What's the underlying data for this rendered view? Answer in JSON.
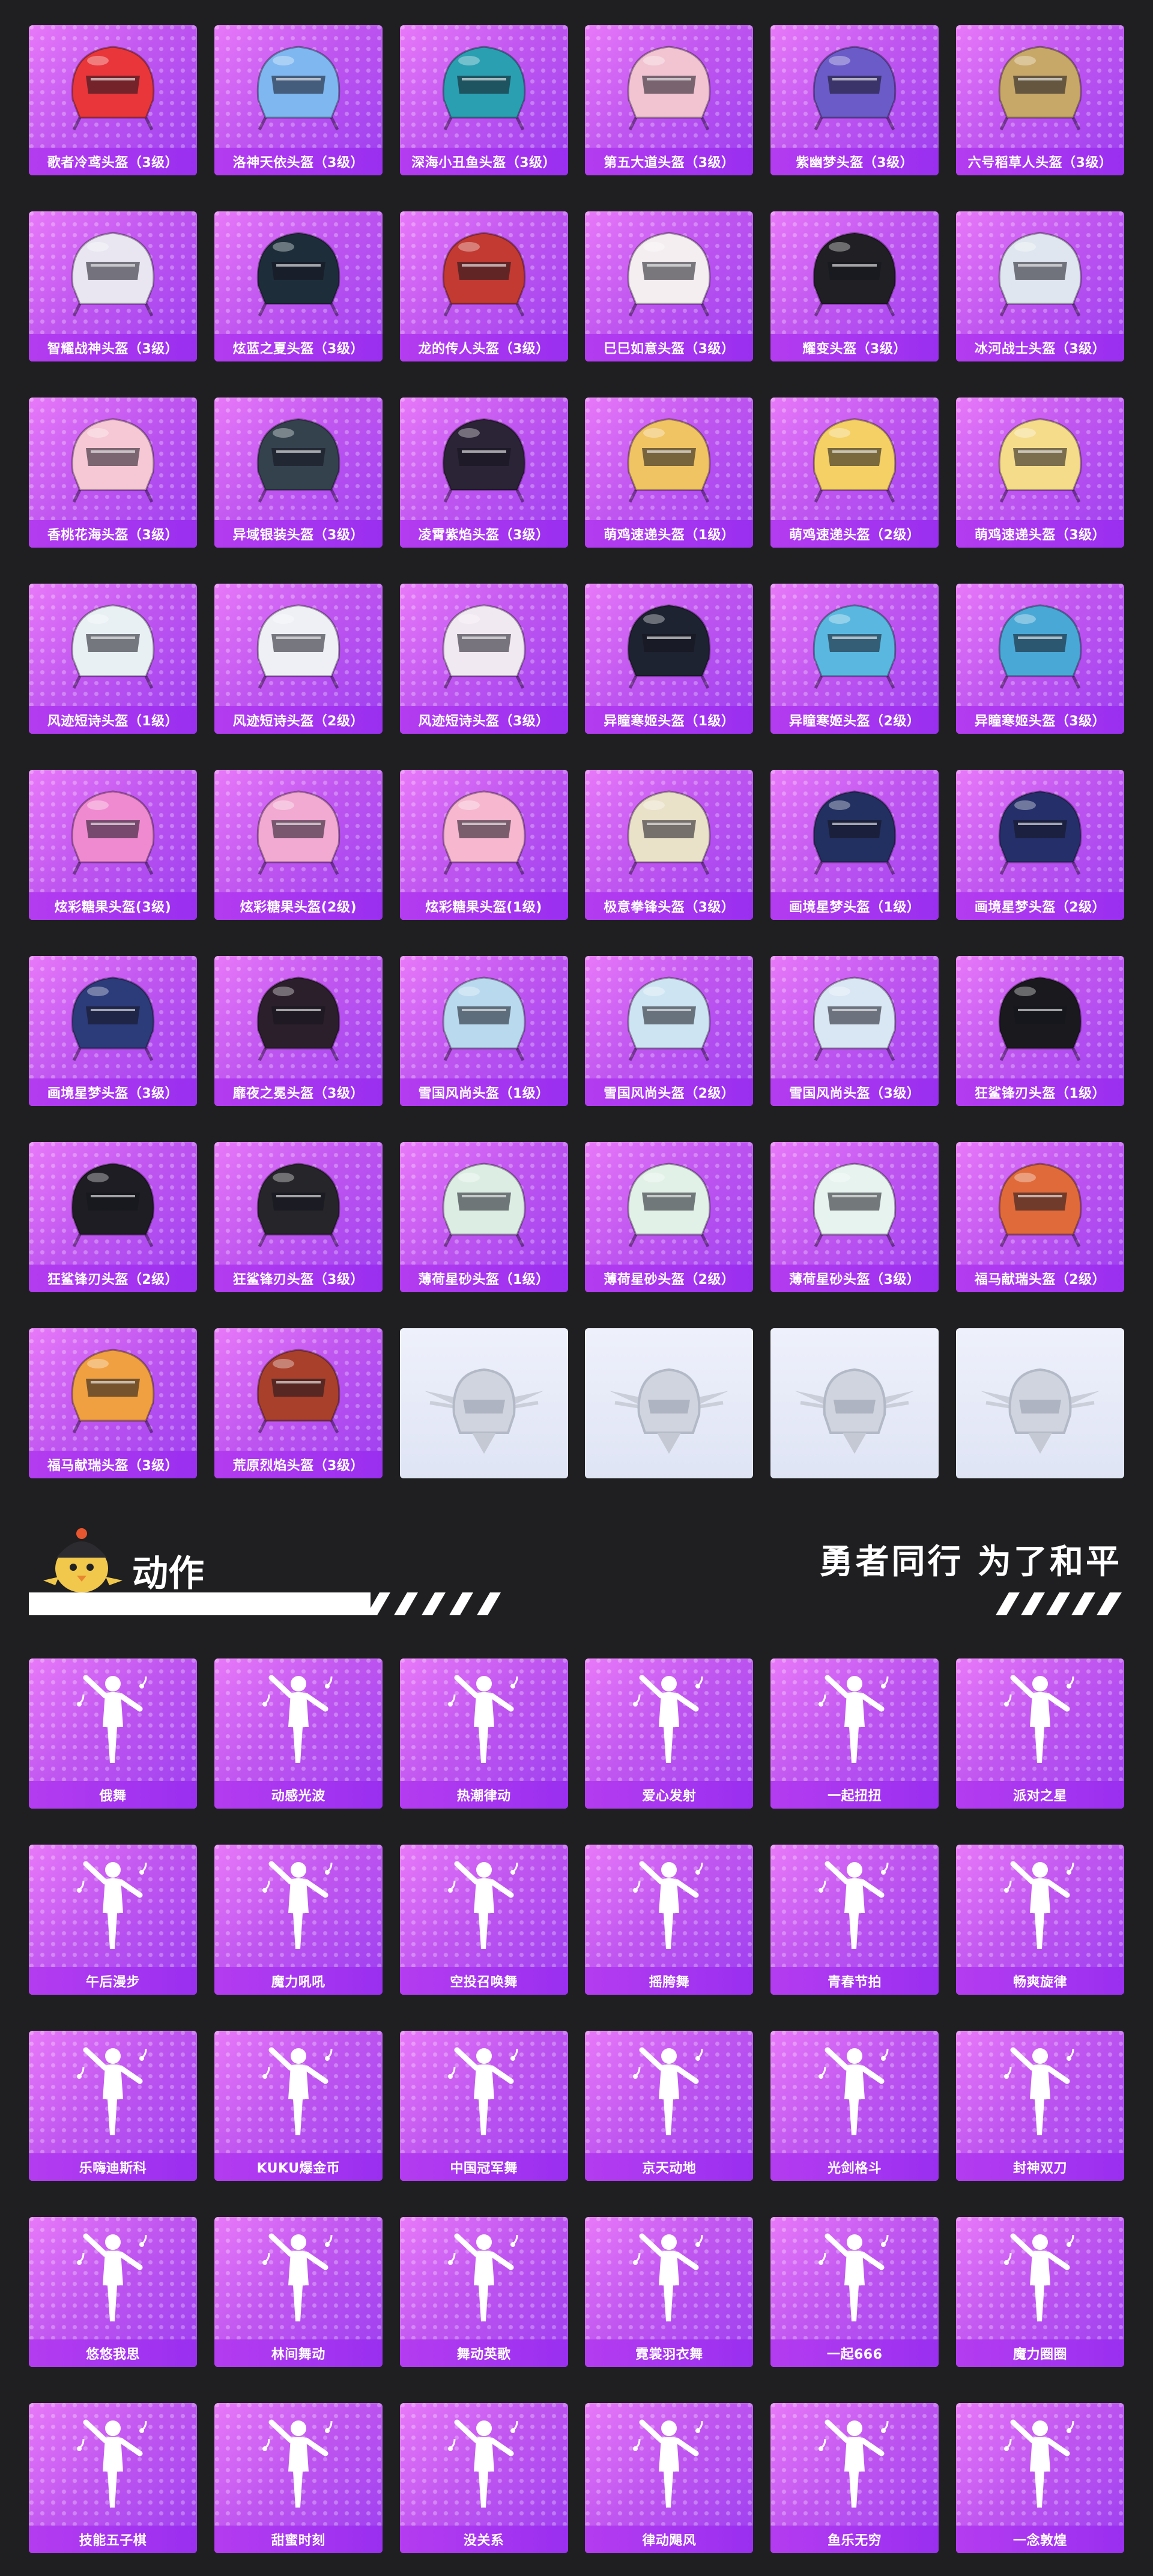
{
  "colors": {
    "background": "#1f1f21",
    "card_gradient_start": "#e879f9",
    "card_gradient_end": "#9b3ef0",
    "label_bar": "#a533f0",
    "placeholder": "#e6eaf8"
  },
  "helmets": [
    {
      "label": "歌者冷鸢头盔（3级）",
      "icon": "helmet-icon",
      "color": "#e8363a"
    },
    {
      "label": "洛神天依头盔（3级）",
      "icon": "helmet-icon",
      "color": "#7fb7f0"
    },
    {
      "label": "深海小丑鱼头盔（3级）",
      "icon": "helmet-icon",
      "color": "#2b9fb2"
    },
    {
      "label": "第五大道头盔（3级）",
      "icon": "helmet-icon",
      "color": "#f2c4d2"
    },
    {
      "label": "紫幽梦头盔（3级）",
      "icon": "helmet-icon",
      "color": "#6b5bc8"
    },
    {
      "label": "六号稻草人头盔（3级）",
      "icon": "helmet-icon",
      "color": "#c8a868"
    },
    {
      "label": "智耀战神头盔（3级）",
      "icon": "helmet-icon",
      "color": "#e9e6f2"
    },
    {
      "label": "炫蓝之夏头盔（3级）",
      "icon": "helmet-icon",
      "color": "#1d2e3a"
    },
    {
      "label": "龙的传人头盔（3级）",
      "icon": "helmet-icon",
      "color": "#c23a32"
    },
    {
      "label": "巳巳如意头盔（3级）",
      "icon": "helmet-icon",
      "color": "#f4eef0"
    },
    {
      "label": "耀变头盔（3级）",
      "icon": "helmet-icon",
      "color": "#1f1f24"
    },
    {
      "label": "冰河战士头盔（3级）",
      "icon": "helmet-icon",
      "color": "#dfe6ef"
    },
    {
      "label": "香桃花海头盔（3级）",
      "icon": "helmet-icon",
      "color": "#f6c7d4"
    },
    {
      "label": "异域银装头盔（3级）",
      "icon": "helmet-icon",
      "color": "#34424e"
    },
    {
      "label": "凌霄紫焰头盔（3级）",
      "icon": "helmet-icon",
      "color": "#2b2336"
    },
    {
      "label": "萌鸡速递头盔（1级）",
      "icon": "helmet-icon",
      "color": "#f0c463"
    },
    {
      "label": "萌鸡速递头盔（2级）",
      "icon": "helmet-icon",
      "color": "#f4d065"
    },
    {
      "label": "萌鸡速递头盔（3级）",
      "icon": "helmet-icon",
      "color": "#f5dc8a"
    },
    {
      "label": "风迹短诗头盔（1级）",
      "icon": "helmet-icon",
      "color": "#e8f0f4"
    },
    {
      "label": "风迹短诗头盔（2级）",
      "icon": "helmet-icon",
      "color": "#eef0f6"
    },
    {
      "label": "风迹短诗头盔（3级）",
      "icon": "helmet-icon",
      "color": "#f1e9f2"
    },
    {
      "label": "异瞳寒姬头盔（1级）",
      "icon": "helmet-icon",
      "color": "#1d2330"
    },
    {
      "label": "异瞳寒姬头盔（2级）",
      "icon": "helmet-icon",
      "color": "#5ab8e0"
    },
    {
      "label": "异瞳寒姬头盔（3级）",
      "icon": "helmet-icon",
      "color": "#4aa8d6"
    },
    {
      "label": "炫彩糖果头盔(3级)",
      "icon": "helmet-icon",
      "color": "#f08ad0"
    },
    {
      "label": "炫彩糖果头盔(2级)",
      "icon": "helmet-icon",
      "color": "#f2a9d2"
    },
    {
      "label": "炫彩糖果头盔(1级)",
      "icon": "helmet-icon",
      "color": "#f6b7cf"
    },
    {
      "label": "极意拳锋头盔（3级）",
      "icon": "helmet-icon",
      "color": "#eae1c9"
    },
    {
      "label": "画境星梦头盔（1级）",
      "icon": "helmet-icon",
      "color": "#223061"
    },
    {
      "label": "画境星梦头盔（2级）",
      "icon": "helmet-icon",
      "color": "#25306a"
    },
    {
      "label": "画境星梦头盔（3级）",
      "icon": "helmet-icon",
      "color": "#2c3b7a"
    },
    {
      "label": "靡夜之冕头盔（3级）",
      "icon": "helmet-icon",
      "color": "#2a1f2b"
    },
    {
      "label": "雪国风尚头盔（1级）",
      "icon": "helmet-icon",
      "color": "#b9d9ee"
    },
    {
      "label": "雪国风尚头盔（2级）",
      "icon": "helmet-icon",
      "color": "#cde4f2"
    },
    {
      "label": "雪国风尚头盔（3级）",
      "icon": "helmet-icon",
      "color": "#d9e6f3"
    },
    {
      "label": "狂鲨锋刃头盔（1级）",
      "icon": "helmet-icon",
      "color": "#1a1a1e"
    },
    {
      "label": "狂鲨锋刃头盔（2级）",
      "icon": "helmet-icon",
      "color": "#1d1d23"
    },
    {
      "label": "狂鲨锋刃头盔（3级）",
      "icon": "helmet-icon",
      "color": "#25252a"
    },
    {
      "label": "薄荷星砂头盔（1级）",
      "icon": "helmet-icon",
      "color": "#dceee4"
    },
    {
      "label": "薄荷星砂头盔（2级）",
      "icon": "helmet-icon",
      "color": "#e2f1e8"
    },
    {
      "label": "薄荷星砂头盔（3级）",
      "icon": "helmet-icon",
      "color": "#e6f3ee"
    },
    {
      "label": "福马献瑞头盔（2级）",
      "icon": "helmet-icon",
      "color": "#e06a3a"
    },
    {
      "label": "福马献瑞头盔（3级）",
      "icon": "helmet-icon",
      "color": "#f0a040"
    },
    {
      "label": "荒原烈焰头盔（3级）",
      "icon": "helmet-icon",
      "color": "#a8402c"
    }
  ],
  "placeholders": [
    {
      "icon": "pubg-emblem-icon"
    },
    {
      "icon": "pubg-emblem-icon"
    },
    {
      "icon": "pubg-emblem-icon"
    },
    {
      "icon": "pubg-emblem-icon"
    }
  ],
  "emote_section": {
    "title": "动作",
    "slogan": "勇者同行 为了和平",
    "mascot_icon": "chick-mascot-icon"
  },
  "emotes": [
    {
      "label": "俄舞",
      "icon": "dance-figure-icon"
    },
    {
      "label": "动感光波",
      "icon": "dance-figure-icon"
    },
    {
      "label": "热潮律动",
      "icon": "dance-figure-icon"
    },
    {
      "label": "爱心发射",
      "icon": "dance-figure-icon"
    },
    {
      "label": "一起扭扭",
      "icon": "dance-figure-icon"
    },
    {
      "label": "派对之星",
      "icon": "dance-figure-icon"
    },
    {
      "label": "午后漫步",
      "icon": "dance-figure-icon"
    },
    {
      "label": "魔力吼吼",
      "icon": "dance-figure-icon"
    },
    {
      "label": "空投召唤舞",
      "icon": "dance-figure-icon"
    },
    {
      "label": "摇胯舞",
      "icon": "dance-figure-icon"
    },
    {
      "label": "青春节拍",
      "icon": "dance-figure-icon"
    },
    {
      "label": "畅爽旋律",
      "icon": "dance-figure-icon"
    },
    {
      "label": "乐嗨迪斯科",
      "icon": "dance-figure-icon"
    },
    {
      "label": "KUKU爆金币",
      "icon": "dance-figure-icon"
    },
    {
      "label": "中国冠军舞",
      "icon": "dance-figure-icon"
    },
    {
      "label": "京天动地",
      "icon": "dance-figure-icon"
    },
    {
      "label": "光剑格斗",
      "icon": "dance-figure-icon"
    },
    {
      "label": "封神双刀",
      "icon": "dance-figure-icon"
    },
    {
      "label": "悠悠我思",
      "icon": "dance-figure-icon"
    },
    {
      "label": "林间舞动",
      "icon": "dance-figure-icon"
    },
    {
      "label": "舞动英歌",
      "icon": "dance-figure-icon"
    },
    {
      "label": "霓裳羽衣舞",
      "icon": "dance-figure-icon"
    },
    {
      "label": "一起666",
      "icon": "dance-figure-icon"
    },
    {
      "label": "魔力圈圈",
      "icon": "dance-figure-icon"
    },
    {
      "label": "技能五子棋",
      "icon": "dance-figure-icon"
    },
    {
      "label": "甜蜜时刻",
      "icon": "dance-figure-icon"
    },
    {
      "label": "没关系",
      "icon": "dance-figure-icon"
    },
    {
      "label": "律动飓风",
      "icon": "dance-figure-icon"
    },
    {
      "label": "鱼乐无穷",
      "icon": "dance-figure-icon"
    },
    {
      "label": "一念敦煌",
      "icon": "dance-figure-icon"
    }
  ]
}
